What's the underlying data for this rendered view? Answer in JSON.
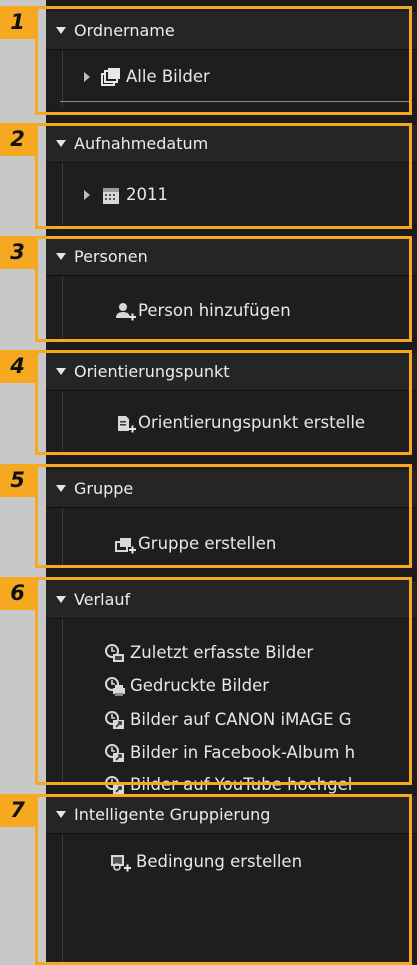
{
  "sections": [
    {
      "title": "Ordnername",
      "badge": "1",
      "items": [
        {
          "label": "Alle Bilder",
          "icon": "folder-stack-icon"
        }
      ]
    },
    {
      "title": "Aufnahmedatum",
      "badge": "2",
      "items": [
        {
          "label": "2011",
          "icon": "calendar-icon"
        }
      ]
    },
    {
      "title": "Personen",
      "badge": "3",
      "items": [
        {
          "label": "Person hinzufügen",
          "icon": "person-add-icon"
        }
      ]
    },
    {
      "title": "Orientierungspunkt",
      "badge": "4",
      "items": [
        {
          "label": "Orientierungspunkt erstelle",
          "icon": "landmark-add-icon"
        }
      ]
    },
    {
      "title": "Gruppe",
      "badge": "5",
      "items": [
        {
          "label": "Gruppe erstellen",
          "icon": "group-add-icon"
        }
      ]
    },
    {
      "title": "Verlauf",
      "badge": "6",
      "items": [
        {
          "label": "Zuletzt erfasste Bilder",
          "icon": "recent-captured-icon"
        },
        {
          "label": "Gedruckte Bilder",
          "icon": "printed-history-icon"
        },
        {
          "label": "Bilder auf CANON iMAGE G",
          "icon": "uploaded-history-icon"
        },
        {
          "label": "Bilder in Facebook-Album h",
          "icon": "uploaded-history-icon"
        },
        {
          "label": "Bilder auf YouTube hochgel",
          "icon": "uploaded-history-icon"
        }
      ]
    },
    {
      "title": "Intelligente Gruppierung",
      "badge": "7",
      "items": [
        {
          "label": "Bedingung erstellen",
          "icon": "condition-add-icon"
        }
      ]
    }
  ],
  "colors": {
    "accent": "#f5a820",
    "panel": "#1c1c1c",
    "header": "#252525",
    "text": "#e8e8e8"
  }
}
